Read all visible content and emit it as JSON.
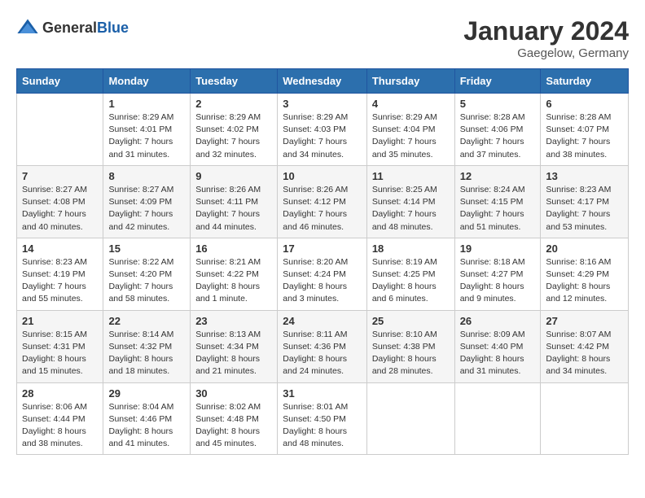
{
  "header": {
    "logo": {
      "text_general": "General",
      "text_blue": "Blue"
    },
    "title": "January 2024",
    "location": "Gaegelow, Germany"
  },
  "calendar": {
    "weekdays": [
      "Sunday",
      "Monday",
      "Tuesday",
      "Wednesday",
      "Thursday",
      "Friday",
      "Saturday"
    ],
    "weeks": [
      [
        {
          "day": "",
          "info": ""
        },
        {
          "day": "1",
          "info": "Sunrise: 8:29 AM\nSunset: 4:01 PM\nDaylight: 7 hours\nand 31 minutes."
        },
        {
          "day": "2",
          "info": "Sunrise: 8:29 AM\nSunset: 4:02 PM\nDaylight: 7 hours\nand 32 minutes."
        },
        {
          "day": "3",
          "info": "Sunrise: 8:29 AM\nSunset: 4:03 PM\nDaylight: 7 hours\nand 34 minutes."
        },
        {
          "day": "4",
          "info": "Sunrise: 8:29 AM\nSunset: 4:04 PM\nDaylight: 7 hours\nand 35 minutes."
        },
        {
          "day": "5",
          "info": "Sunrise: 8:28 AM\nSunset: 4:06 PM\nDaylight: 7 hours\nand 37 minutes."
        },
        {
          "day": "6",
          "info": "Sunrise: 8:28 AM\nSunset: 4:07 PM\nDaylight: 7 hours\nand 38 minutes."
        }
      ],
      [
        {
          "day": "7",
          "info": "Sunrise: 8:27 AM\nSunset: 4:08 PM\nDaylight: 7 hours\nand 40 minutes."
        },
        {
          "day": "8",
          "info": "Sunrise: 8:27 AM\nSunset: 4:09 PM\nDaylight: 7 hours\nand 42 minutes."
        },
        {
          "day": "9",
          "info": "Sunrise: 8:26 AM\nSunset: 4:11 PM\nDaylight: 7 hours\nand 44 minutes."
        },
        {
          "day": "10",
          "info": "Sunrise: 8:26 AM\nSunset: 4:12 PM\nDaylight: 7 hours\nand 46 minutes."
        },
        {
          "day": "11",
          "info": "Sunrise: 8:25 AM\nSunset: 4:14 PM\nDaylight: 7 hours\nand 48 minutes."
        },
        {
          "day": "12",
          "info": "Sunrise: 8:24 AM\nSunset: 4:15 PM\nDaylight: 7 hours\nand 51 minutes."
        },
        {
          "day": "13",
          "info": "Sunrise: 8:23 AM\nSunset: 4:17 PM\nDaylight: 7 hours\nand 53 minutes."
        }
      ],
      [
        {
          "day": "14",
          "info": "Sunrise: 8:23 AM\nSunset: 4:19 PM\nDaylight: 7 hours\nand 55 minutes."
        },
        {
          "day": "15",
          "info": "Sunrise: 8:22 AM\nSunset: 4:20 PM\nDaylight: 7 hours\nand 58 minutes."
        },
        {
          "day": "16",
          "info": "Sunrise: 8:21 AM\nSunset: 4:22 PM\nDaylight: 8 hours\nand 1 minute."
        },
        {
          "day": "17",
          "info": "Sunrise: 8:20 AM\nSunset: 4:24 PM\nDaylight: 8 hours\nand 3 minutes."
        },
        {
          "day": "18",
          "info": "Sunrise: 8:19 AM\nSunset: 4:25 PM\nDaylight: 8 hours\nand 6 minutes."
        },
        {
          "day": "19",
          "info": "Sunrise: 8:18 AM\nSunset: 4:27 PM\nDaylight: 8 hours\nand 9 minutes."
        },
        {
          "day": "20",
          "info": "Sunrise: 8:16 AM\nSunset: 4:29 PM\nDaylight: 8 hours\nand 12 minutes."
        }
      ],
      [
        {
          "day": "21",
          "info": "Sunrise: 8:15 AM\nSunset: 4:31 PM\nDaylight: 8 hours\nand 15 minutes."
        },
        {
          "day": "22",
          "info": "Sunrise: 8:14 AM\nSunset: 4:32 PM\nDaylight: 8 hours\nand 18 minutes."
        },
        {
          "day": "23",
          "info": "Sunrise: 8:13 AM\nSunset: 4:34 PM\nDaylight: 8 hours\nand 21 minutes."
        },
        {
          "day": "24",
          "info": "Sunrise: 8:11 AM\nSunset: 4:36 PM\nDaylight: 8 hours\nand 24 minutes."
        },
        {
          "day": "25",
          "info": "Sunrise: 8:10 AM\nSunset: 4:38 PM\nDaylight: 8 hours\nand 28 minutes."
        },
        {
          "day": "26",
          "info": "Sunrise: 8:09 AM\nSunset: 4:40 PM\nDaylight: 8 hours\nand 31 minutes."
        },
        {
          "day": "27",
          "info": "Sunrise: 8:07 AM\nSunset: 4:42 PM\nDaylight: 8 hours\nand 34 minutes."
        }
      ],
      [
        {
          "day": "28",
          "info": "Sunrise: 8:06 AM\nSunset: 4:44 PM\nDaylight: 8 hours\nand 38 minutes."
        },
        {
          "day": "29",
          "info": "Sunrise: 8:04 AM\nSunset: 4:46 PM\nDaylight: 8 hours\nand 41 minutes."
        },
        {
          "day": "30",
          "info": "Sunrise: 8:02 AM\nSunset: 4:48 PM\nDaylight: 8 hours\nand 45 minutes."
        },
        {
          "day": "31",
          "info": "Sunrise: 8:01 AM\nSunset: 4:50 PM\nDaylight: 8 hours\nand 48 minutes."
        },
        {
          "day": "",
          "info": ""
        },
        {
          "day": "",
          "info": ""
        },
        {
          "day": "",
          "info": ""
        }
      ]
    ]
  }
}
